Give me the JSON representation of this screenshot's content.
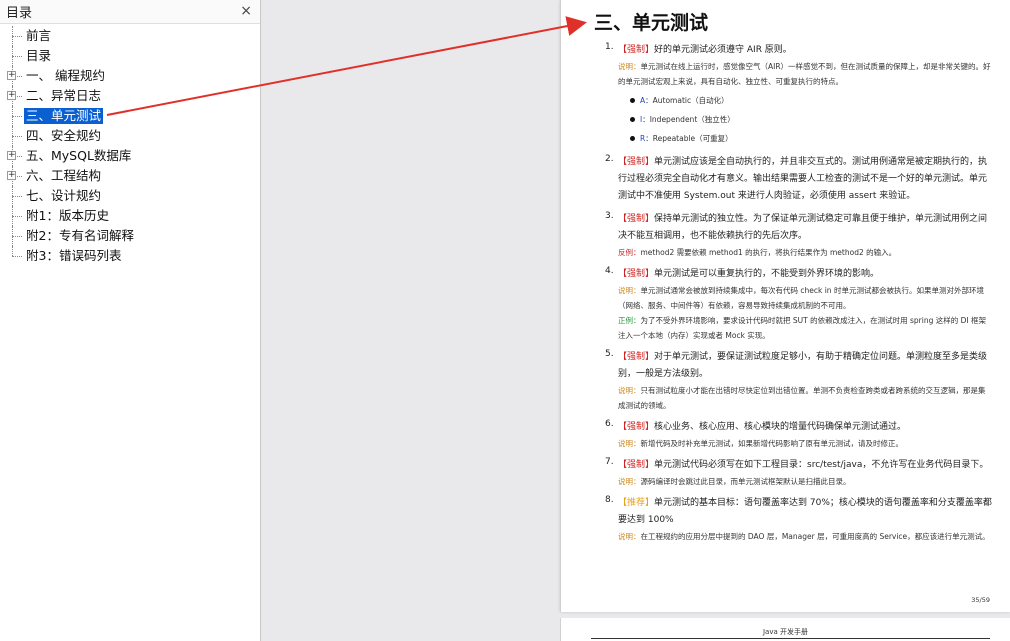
{
  "toc": {
    "title": "目录",
    "close_label": "×",
    "items": [
      {
        "label": "前言",
        "expandable": false
      },
      {
        "label": "目录",
        "expandable": false
      },
      {
        "label": "一、 编程规约",
        "expandable": true
      },
      {
        "label": "二、异常日志",
        "expandable": true
      },
      {
        "label": "三、单元测试",
        "expandable": false,
        "selected": true
      },
      {
        "label": "四、安全规约",
        "expandable": false
      },
      {
        "label": "五、MySQL数据库",
        "expandable": true
      },
      {
        "label": "六、工程结构",
        "expandable": true
      },
      {
        "label": "七、设计规约",
        "expandable": false
      },
      {
        "label": "附1：版本历史",
        "expandable": false
      },
      {
        "label": "附2：专有名词解释",
        "expandable": false
      },
      {
        "label": "附3：错误码列表",
        "expandable": false
      }
    ]
  },
  "document": {
    "section_title": "三、单元测试",
    "page_number": "35/59",
    "next_page_header": "Java 开发手册",
    "items": [
      {
        "num": "1.",
        "tag": "【强制】",
        "text": "好的单元测试必须遵守 AIR 原则。",
        "note_label": "说明：",
        "note": "单元测试在线上运行时，感觉像空气（AIR）一样感觉不到，但在测试质量的保障上，却是非常关键的。好的单元测试宏观上来说，具有自动化、独立性、可重复执行的特点。",
        "bullets": [
          {
            "key": "A",
            "text": "：Automatic（自动化）"
          },
          {
            "key": "I",
            "text": "：Independent（独立性）"
          },
          {
            "key": "R",
            "text": "：Repeatable（可重复）"
          }
        ]
      },
      {
        "num": "2.",
        "tag": "【强制】",
        "text": "单元测试应该是全自动执行的，并且非交互式的。测试用例通常是被定期执行的，执行过程必须完全自动化才有意义。输出结果需要人工检查的测试不是一个好的单元测试。单元测试中不准使用 System.out 来进行人肉验证，必须使用 assert 来验证。"
      },
      {
        "num": "3.",
        "tag": "【强制】",
        "text": "保持单元测试的独立性。为了保证单元测试稳定可靠且便于维护，单元测试用例之间决不能互相调用，也不能依赖执行的先后次序。",
        "note_label": "反例：",
        "note_kind": "neg",
        "note": "method2 需要依赖 method1 的执行，将执行结果作为 method2 的输入。"
      },
      {
        "num": "4.",
        "tag": "【强制】",
        "text": "单元测试是可以重复执行的，不能受到外界环境的影响。",
        "note_label": "说明：",
        "note": "单元测试通常会被放到持续集成中，每次有代码 check in 时单元测试都会被执行。如果单测对外部环境（网络、服务、中间件等）有依赖，容易导致持续集成机制的不可用。",
        "note2_label": "正例：",
        "note2": "为了不受外界环境影响，要求设计代码时就把 SUT 的依赖改成注入，在测试时用 spring 这样的 DI 框架注入一个本地（内存）实现或者 Mock 实现。"
      },
      {
        "num": "5.",
        "tag": "【强制】",
        "text": "对于单元测试，要保证测试粒度足够小，有助于精确定位问题。单测粒度至多是类级别，一般是方法级别。",
        "note_label": "说明：",
        "note": "只有测试粒度小才能在出错时尽快定位到出错位置。单测不负责检查跨类或者跨系统的交互逻辑，那是集成测试的领域。"
      },
      {
        "num": "6.",
        "tag": "【强制】",
        "text": "核心业务、核心应用、核心模块的增量代码确保单元测试通过。",
        "note_label": "说明：",
        "note": "新增代码及时补充单元测试，如果新增代码影响了原有单元测试，请及时修正。"
      },
      {
        "num": "7.",
        "tag": "【强制】",
        "text": "单元测试代码必须写在如下工程目录：src/test/java，不允许写在业务代码目录下。",
        "note_label": "说明：",
        "note": "源码编译时会跳过此目录，而单元测试框架默认是扫描此目录。"
      },
      {
        "num": "8.",
        "tag": "【推荐】",
        "tag_kind": "rec",
        "text": "单元测试的基本目标：语句覆盖率达到 70%；核心模块的语句覆盖率和分支覆盖率都要达到 100%",
        "note_label": "说明：",
        "note": "在工程规约的应用分层中提到的 DAO 层，Manager 层，可重用度高的 Service，都应该进行单元测试。"
      }
    ]
  },
  "annotation": {
    "color": "#e0302a"
  }
}
